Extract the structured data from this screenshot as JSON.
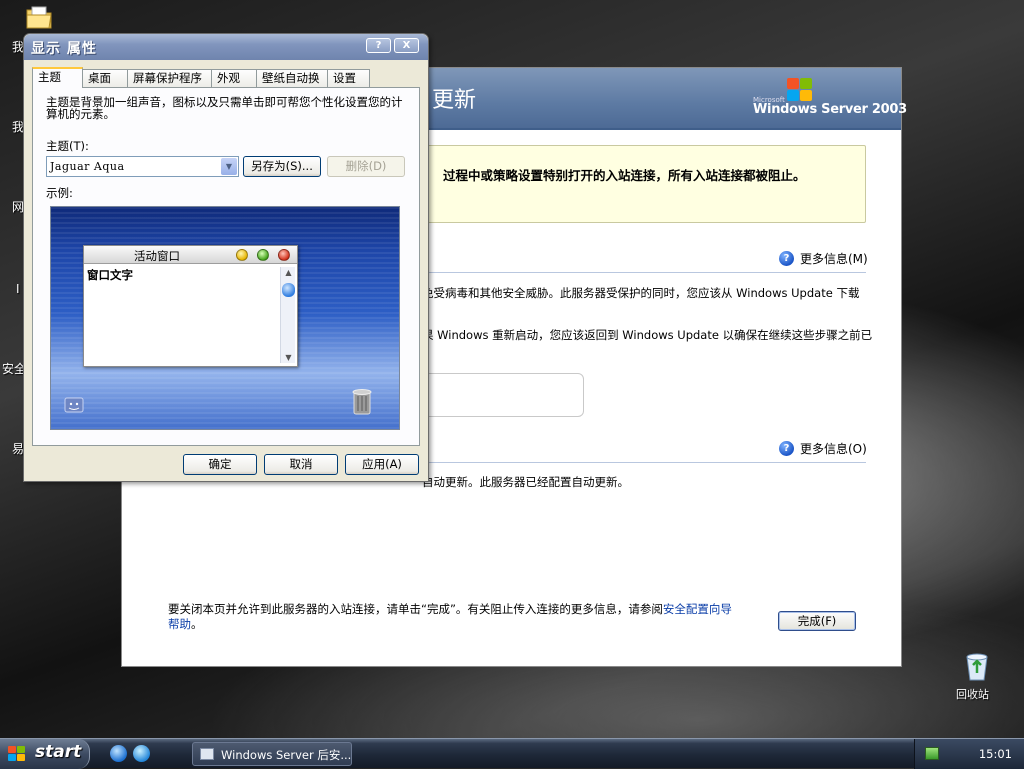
{
  "desktop": {
    "icons": [
      {
        "label": "回收站"
      }
    ],
    "edge_labels": [
      "我",
      "我",
      "网",
      "I",
      "安全",
      "易"
    ]
  },
  "background_window": {
    "banner_title": "更新",
    "logo_microsoft": "Microsoft",
    "logo_name": "Windows Server 2003",
    "warning_text": "过程中或策略设置特别打开的入站连接，所有入站连接都被阻止。",
    "more_info_1": "更多信息(M)",
    "line_1": "免受病毒和其他安全威胁。此服务器受保护的同时，您应该从 Windows Update 下载",
    "line_2": "果 Windows 重新启动，您应该返回到 Windows Update 以确保在继续这些步骤之前已",
    "more_info_2": "更多信息(O)",
    "line_3": "自动更新。此服务器已经配置自动更新。",
    "footer_text": "要关闭本页并允许到此服务器的入站连接，请单击“完成”。有关阻止传入连接的更多信息，请参阅",
    "footer_link": "安全配置向导",
    "footer_link_2": "帮助",
    "finish_label": "完成(F)"
  },
  "dialog": {
    "title": "显示 属性",
    "help_btn": "?",
    "close_btn": "X",
    "tabs": [
      {
        "label": "主题",
        "active": true
      },
      {
        "label": "桌面",
        "active": false
      },
      {
        "label": "屏幕保护程序",
        "active": false
      },
      {
        "label": "外观",
        "active": false
      },
      {
        "label": "壁纸自动换",
        "active": false
      },
      {
        "label": "设置",
        "active": false
      }
    ],
    "description": "主题是背景加一组声音，图标以及只需单击即可帮您个性化设置您的计算机的元素。",
    "theme_label": "主题(T):",
    "theme_value": "Jaguar Aqua",
    "save_as_label": "另存为(S)...",
    "delete_label": "删除(D)",
    "sample_label": "示例:",
    "preview": {
      "window_title": "活动窗口",
      "window_text": "窗口文字"
    },
    "ok_label": "确定",
    "cancel_label": "取消",
    "apply_label": "应用(A)"
  },
  "taskbar": {
    "start_label": "start",
    "task_label": "Windows Server 后安...",
    "clock": "15:01"
  },
  "colors": {
    "xp_flag": [
      "#f35325",
      "#81bc06",
      "#05a6f0",
      "#ffba08"
    ],
    "tab_highlight": "#ffc83c",
    "link": "#0b3ea8"
  }
}
